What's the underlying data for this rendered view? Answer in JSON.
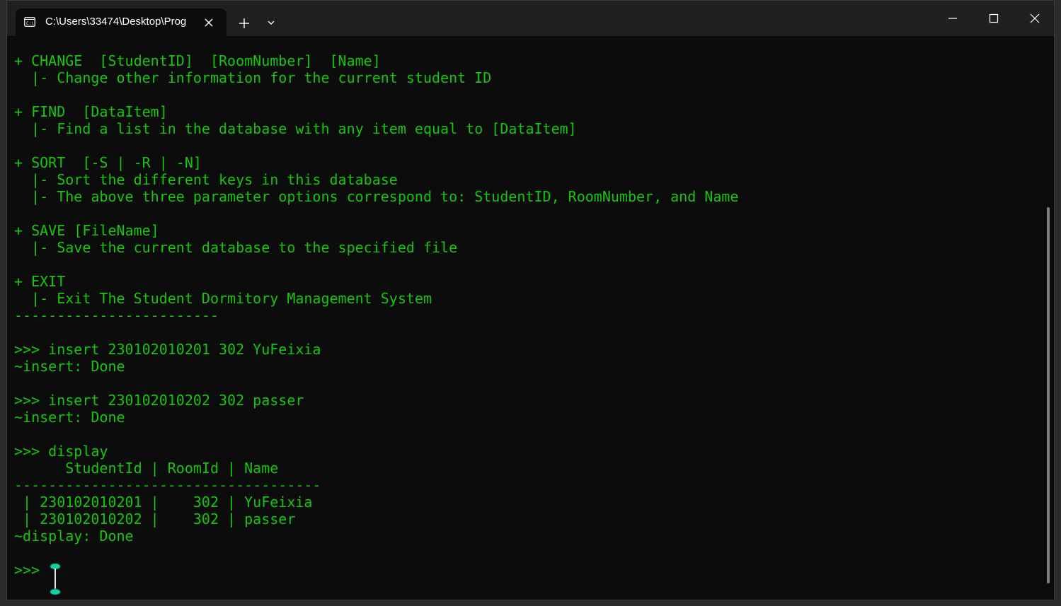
{
  "window": {
    "tab_title": "C:\\Users\\33474\\Desktop\\Prog"
  },
  "terminal": {
    "lines": [
      "+ CHANGE  [StudentID]  [RoomNumber]  [Name]",
      "  |- Change other information for the current student ID",
      "",
      "+ FIND  [DataItem]",
      "  |- Find a list in the database with any item equal to [DataItem]",
      "",
      "+ SORT  [-S | -R | -N]",
      "  |- Sort the different keys in this database",
      "  |- The above three parameter options correspond to: StudentID, RoomNumber, and Name",
      "",
      "+ SAVE [FileName]",
      "  |- Save the current database to the specified file",
      "",
      "+ EXIT",
      "  |- Exit The Student Dormitory Management System",
      "------------------------",
      "",
      ">>> insert 230102010201 302 YuFeixia",
      "~insert: Done",
      "",
      ">>> insert 230102010202 302 passer",
      "~insert: Done",
      "",
      ">>> display",
      "      StudentId | RoomId | Name",
      "------------------------------------",
      " | 230102010201 |    302 | YuFeixia",
      " | 230102010202 |    302 | passer",
      "~display: Done",
      "",
      ">>> "
    ]
  },
  "colors": {
    "terminal_text": "#16c60c",
    "terminal_bg": "#0c0c0c",
    "titlebar_bg": "#202020",
    "cursor": "#12d3a6"
  }
}
